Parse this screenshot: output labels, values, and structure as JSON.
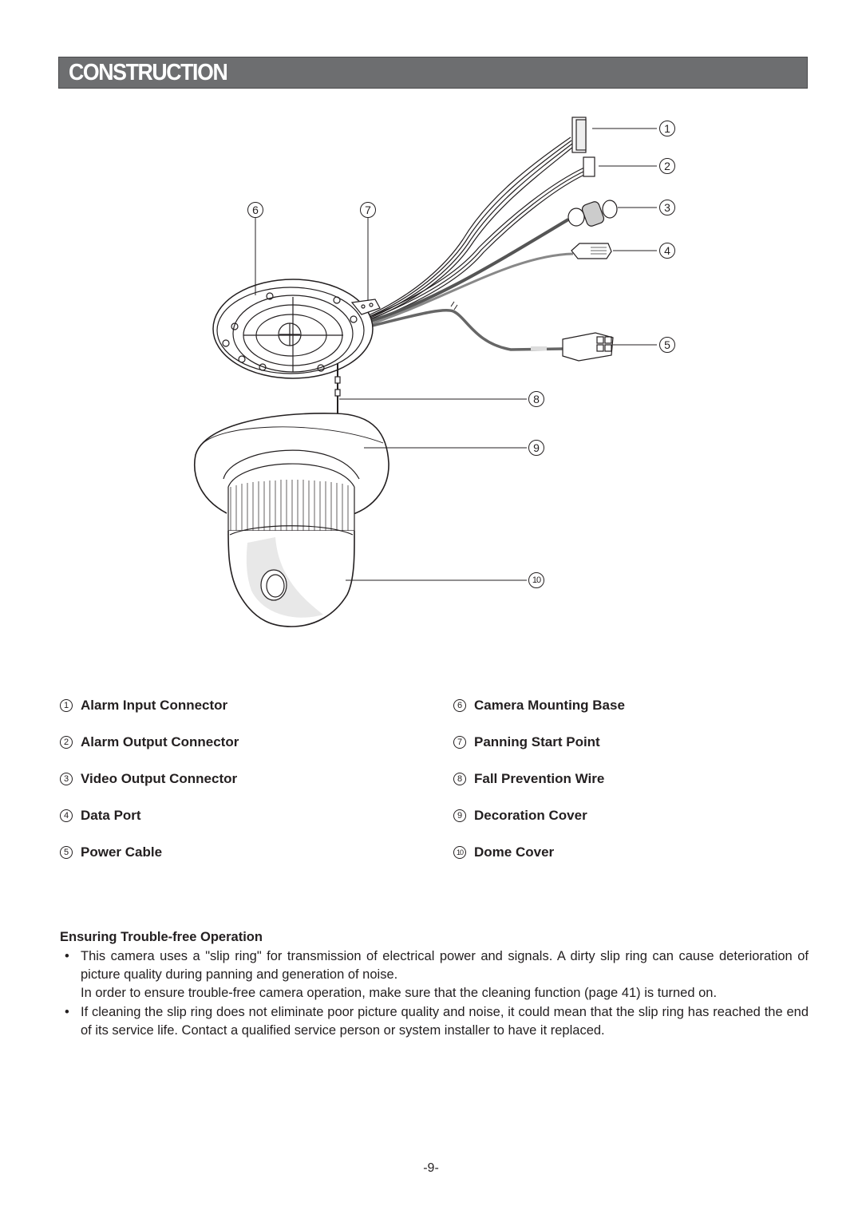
{
  "header": {
    "title": "CONSTRUCTION",
    "bar_color": "#6d6e70"
  },
  "diagram": {
    "callouts": [
      {
        "num": "1",
        "part": "Alarm Input Connector"
      },
      {
        "num": "2",
        "part": "Alarm Output Connector"
      },
      {
        "num": "3",
        "part": "Video Output Connector"
      },
      {
        "num": "4",
        "part": "Data Port"
      },
      {
        "num": "5",
        "part": "Power Cable"
      },
      {
        "num": "6",
        "part": "Camera Mounting Base"
      },
      {
        "num": "7",
        "part": "Panning Start Point"
      },
      {
        "num": "8",
        "part": "Fall Prevention Wire"
      },
      {
        "num": "9",
        "part": "Decoration Cover"
      },
      {
        "num": "10",
        "part": "Dome Cover"
      }
    ]
  },
  "parts_list": {
    "left": [
      {
        "num": "1",
        "label": "Alarm Input Connector"
      },
      {
        "num": "2",
        "label": "Alarm Output Connector"
      },
      {
        "num": "3",
        "label": "Video Output Connector"
      },
      {
        "num": "4",
        "label": "Data Port"
      },
      {
        "num": "5",
        "label": "Power Cable"
      }
    ],
    "right": [
      {
        "num": "6",
        "label": "Camera Mounting Base"
      },
      {
        "num": "7",
        "label": "Panning Start Point"
      },
      {
        "num": "8",
        "label": "Fall Prevention Wire"
      },
      {
        "num": "9",
        "label": "Decoration Cover"
      },
      {
        "num": "10",
        "label": "Dome Cover"
      }
    ]
  },
  "trouble_free": {
    "heading": "Ensuring Trouble-free Operation",
    "bullets": [
      {
        "marker": "•",
        "paragraphs": [
          "This camera uses a \"slip ring\" for transmission of electrical power and signals. A dirty slip ring can cause deterioration of picture quality during panning and generation of noise.",
          "In order to ensure trouble-free camera operation, make sure that the cleaning function (page 41) is turned on."
        ]
      },
      {
        "marker": "•",
        "paragraphs": [
          "If cleaning the slip ring does not eliminate poor picture quality and noise, it could mean that the slip ring has reached the end of its service life. Contact a qualified service person or system installer to have it replaced."
        ]
      }
    ]
  },
  "footer": {
    "page_number": "-9-"
  }
}
